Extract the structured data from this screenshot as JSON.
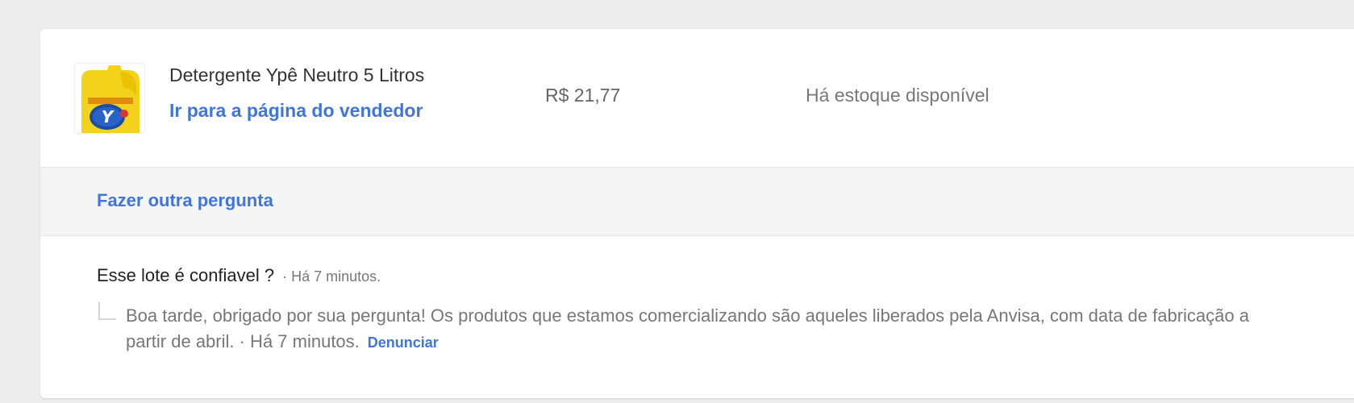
{
  "product": {
    "title": "Detergente Ypê Neutro 5 Litros",
    "seller_link": "Ir para a página do vendedor",
    "price": "R$ 21,77",
    "stock": "Há estoque disponível",
    "image_icon": "detergent-bottle-image"
  },
  "actions": {
    "ask_another": "Fazer outra pergunta"
  },
  "qa": {
    "question": "Esse lote é confiavel ?",
    "question_time": "· Há 7 minutos.",
    "answer": "Boa tarde, obrigado por sua pergunta! Os produtos que estamos comercializando são aqueles liberados pela Anvisa, com data de fabricação a partir de abril. ·  Há 7 minutos.",
    "report_label": "Denunciar"
  },
  "colors": {
    "link": "#3f75e0",
    "background": "#ededed",
    "card": "#ffffff",
    "section": "#f5f5f5"
  }
}
